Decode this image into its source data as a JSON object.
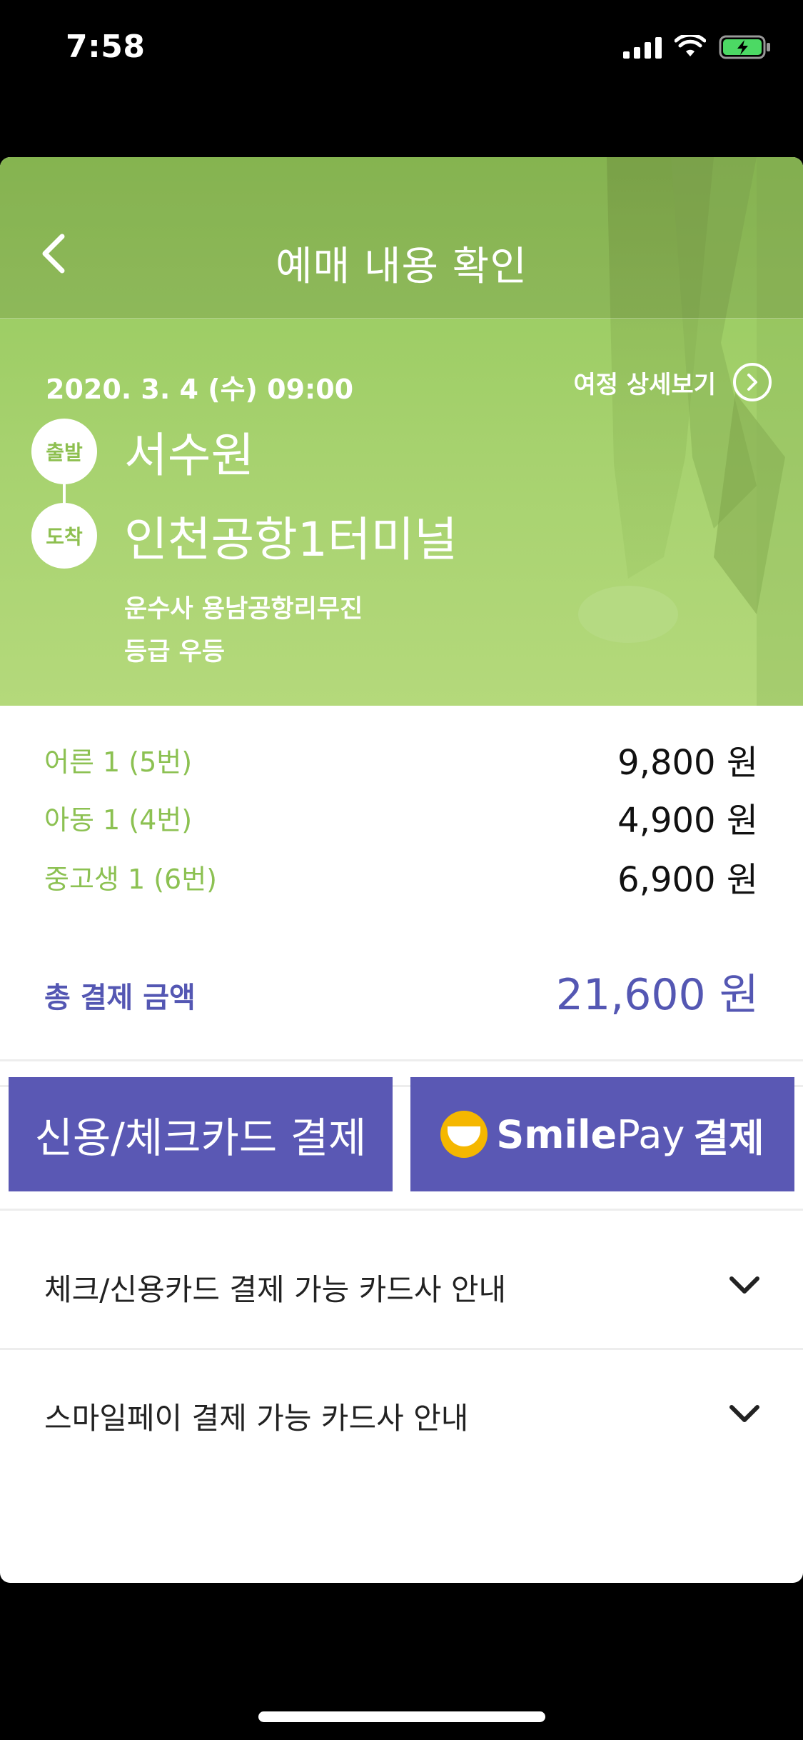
{
  "status_bar": {
    "time": "7:58"
  },
  "header": {
    "title": "예매 내용 확인"
  },
  "trip": {
    "date": "2020. 3. 4 (수) 09:00",
    "detail_link": "여정 상세보기",
    "departure": {
      "badge": "출발",
      "name": "서수원"
    },
    "arrival": {
      "badge": "도착",
      "name": "인천공항1터미널"
    },
    "carrier_line": "운수사  용남공항리무진",
    "grade_line": "등급 우등"
  },
  "fares": [
    {
      "label": "어른 1 (5번)",
      "amount": "9,800 원"
    },
    {
      "label": "아동 1 (4번)",
      "amount": "4,900 원"
    },
    {
      "label": "중고생 1 (6번)",
      "amount": "6,900 원"
    }
  ],
  "total": {
    "label": "총 결제 금액",
    "amount": "21,600 원"
  },
  "payment": {
    "card_label": "신용/체크카드 결제",
    "smilepay_brand": "Smile",
    "smilepay_brand2": "Pay",
    "smilepay_suffix": "결제"
  },
  "accordions": [
    {
      "label": "체크/신용카드 결제 가능 카드사 안내"
    },
    {
      "label": "스마일페이 결제 가능 카드사 안내"
    }
  ],
  "colors": {
    "accent_green": "#8cc152",
    "brand_purple": "#5a58b4",
    "total_purple": "#5457b3",
    "smile_yellow": "#f5b700"
  }
}
